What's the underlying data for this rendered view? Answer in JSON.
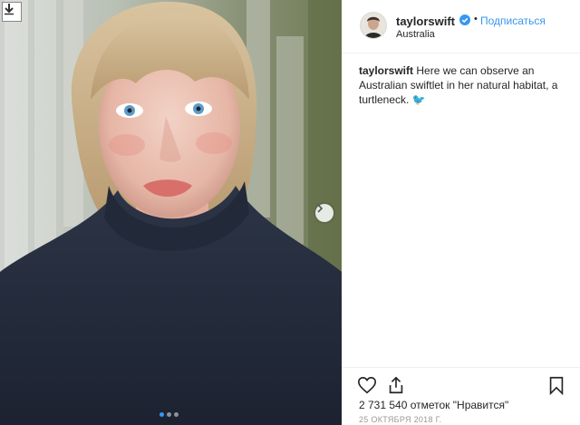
{
  "post": {
    "username": "taylorswift",
    "bullet": "•",
    "follow_label": "Подписаться",
    "location": "Australia",
    "caption": {
      "username": "taylorswift",
      "text": "Here we can observe an Australian swiftlet in her natural habitat, a turtleneck. 🐦"
    },
    "likes_text": "2 731 540 отметок \"Нравится\"",
    "date": "25 ОКТЯБРЯ 2018 Г.",
    "carousel": {
      "total": 3,
      "active": 1
    }
  },
  "icons": {
    "download": "download-arrow-icon",
    "next": "chevron-right-icon",
    "verified": "verified-badge-icon",
    "like": "heart-icon",
    "share": "share-icon",
    "save": "bookmark-icon"
  },
  "colors": {
    "accent": "#3897f0",
    "text": "#262626",
    "muted": "#999999",
    "divider": "#efefef"
  }
}
